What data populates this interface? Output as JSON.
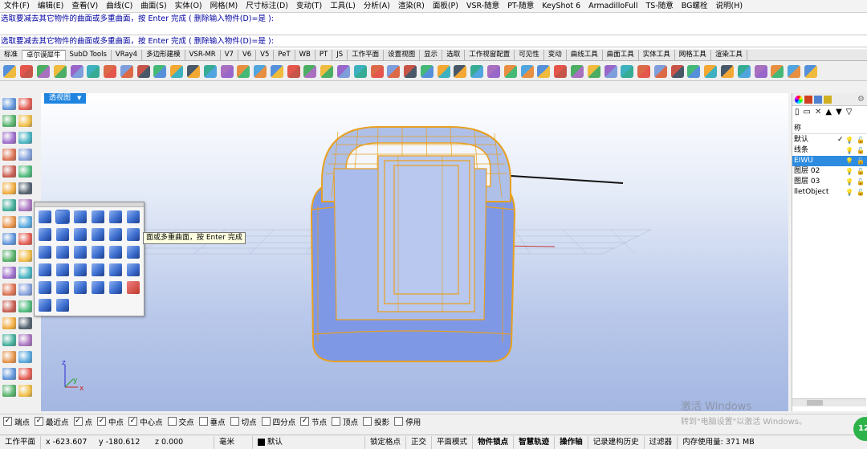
{
  "menu": [
    "文件(F)",
    "编辑(E)",
    "查看(V)",
    "曲线(C)",
    "曲面(S)",
    "实体(O)",
    "网格(M)",
    "尺寸标注(D)",
    "变动(T)",
    "工具(L)",
    "分析(A)",
    "渲染(R)",
    "面板(P)",
    "VSR-随意",
    "PT-随意",
    "KeyShot 6",
    "ArmadilloFull",
    "TS-随意",
    "BG螺栓",
    "说明(H)"
  ],
  "command": {
    "history": "选取要减去其它物件的曲面或多重曲面，按 Enter 完成 ( 删除输入物件(D)=是 ):",
    "prompt": "选取要减去其它物件的曲面或多重曲面，按 Enter 完成 ( 删除输入物件(D)=是 ):"
  },
  "tabs": [
    "标准",
    "卓尔谟犀牛",
    "SubD Tools",
    "VRay4",
    "多边形建模",
    "VSR-MR",
    "V7",
    "V6",
    "V5",
    "PeT",
    "WB",
    "PT",
    "JS",
    "工作平面",
    "设置视图",
    "显示",
    "选取",
    "工作视窗配置",
    "可见性",
    "变动",
    "曲线工具",
    "曲面工具",
    "实体工具",
    "网格工具",
    "渲染工具"
  ],
  "viewport": {
    "label": "透视图"
  },
  "tooltip": "面或多重曲面，按 Enter 完成",
  "axes": {
    "x": "x",
    "y": "y",
    "z": "z"
  },
  "layers": {
    "header": "称",
    "rows": [
      {
        "name": "默认",
        "current": "✓"
      },
      {
        "name": "线条",
        "current": ""
      },
      {
        "name": "EIWU",
        "current": ""
      },
      {
        "name": "图层 02",
        "current": ""
      },
      {
        "name": "图层 03",
        "current": ""
      },
      {
        "name": "lletObject",
        "current": ""
      }
    ]
  },
  "snaps": [
    {
      "label": "端点",
      "checked": true
    },
    {
      "label": "最近点",
      "checked": true
    },
    {
      "label": "点",
      "checked": true
    },
    {
      "label": "中点",
      "checked": true
    },
    {
      "label": "中心点",
      "checked": true
    },
    {
      "label": "交点",
      "checked": false
    },
    {
      "label": "垂点",
      "checked": false
    },
    {
      "label": "切点",
      "checked": false
    },
    {
      "label": "四分点",
      "checked": false
    },
    {
      "label": "节点",
      "checked": true
    },
    {
      "label": "顶点",
      "checked": false
    },
    {
      "label": "投影",
      "checked": false
    },
    {
      "label": "停用",
      "checked": false
    }
  ],
  "status": {
    "plane": "工作平面",
    "x": "x -623.607",
    "y": "y -180.612",
    "z": "z 0.000",
    "unit": "毫米",
    "layer": "默认",
    "lock_grid": "锁定格点",
    "ortho": "正交",
    "planar": "平面模式",
    "osnap": "物件锁点",
    "smarttrack": "智慧轨迹",
    "gumball": "操作轴",
    "history": "记录建构历史",
    "filter": "过滤器",
    "memory": "内存使用量: 371 MB"
  },
  "watermark": {
    "title": "激活 Windows",
    "sub": "转到\"电脑设置\"以激活 Windows。"
  },
  "badge": "12",
  "colors": {
    "accent": "#1e84e0",
    "wire": "#e8a020",
    "model": "#7f98e6"
  }
}
